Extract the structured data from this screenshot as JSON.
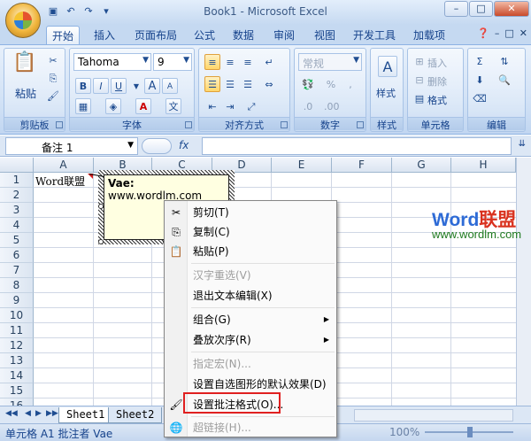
{
  "window": {
    "title": "Book1 - Microsoft Excel"
  },
  "qat": [
    "save-icon",
    "undo-icon",
    "redo-icon",
    "customize-icon"
  ],
  "tabs": [
    "开始",
    "插入",
    "页面布局",
    "公式",
    "数据",
    "审阅",
    "视图",
    "开发工具",
    "加载项"
  ],
  "ribbon": {
    "groups": [
      "剪贴板",
      "字体",
      "对齐方式",
      "数字",
      "样式",
      "单元格",
      "编辑"
    ],
    "paste_label": "粘贴",
    "font_name": "Tahoma",
    "font_size": "9",
    "number_format": "常规",
    "style_label": "样式",
    "insert_label": "插入",
    "delete_label": "删除",
    "format_label": "格式",
    "bold": "B",
    "italic": "I",
    "underline": "U",
    "grow": "A",
    "shrink": "A",
    "percent": "%",
    "comma": ","
  },
  "formula_bar": {
    "name_box": "备注 1",
    "fx": "fx",
    "value": ""
  },
  "grid": {
    "columns": [
      "A",
      "B",
      "C",
      "D",
      "E",
      "F",
      "G",
      "H"
    ],
    "rows": [
      "1",
      "2",
      "3",
      "4",
      "5",
      "6",
      "7",
      "8",
      "9",
      "10",
      "11",
      "12",
      "13",
      "14",
      "15",
      "16"
    ],
    "a1": "Word联盟"
  },
  "comment": {
    "author": "Vae:",
    "text": "www.wordlm.com"
  },
  "watermark": {
    "word": "Word",
    "rest": "联盟",
    "url": "www.wordlm.com"
  },
  "context_menu": [
    {
      "label": "剪切(T)",
      "icon": "scissors-icon",
      "enabled": true
    },
    {
      "label": "复制(C)",
      "icon": "copy-icon",
      "enabled": true
    },
    {
      "label": "粘贴(P)",
      "icon": "paste-icon",
      "enabled": true
    },
    {
      "label": "汉字重选(V)",
      "enabled": false
    },
    {
      "label": "退出文本编辑(X)",
      "enabled": true
    },
    {
      "label": "组合(G)",
      "enabled": true,
      "submenu": true
    },
    {
      "label": "叠放次序(R)",
      "enabled": true,
      "submenu": true
    },
    {
      "label": "指定宏(N)...",
      "enabled": false
    },
    {
      "label": "设置自选图形的默认效果(D)",
      "enabled": true
    },
    {
      "label": "设置批注格式(O)...",
      "icon": "format-comment-icon",
      "enabled": true,
      "highlighted": true
    },
    {
      "label": "超链接(H)...",
      "icon": "hyperlink-icon",
      "enabled": false
    }
  ],
  "sheets": [
    "Sheet1",
    "Sheet2"
  ],
  "status": {
    "text": "单元格 A1 批注者 Vae",
    "zoom": "100%"
  },
  "colors": {
    "highlight": "#e02020",
    "comment_bg": "#ffffe1",
    "ribbon": "#cfe0f5"
  }
}
